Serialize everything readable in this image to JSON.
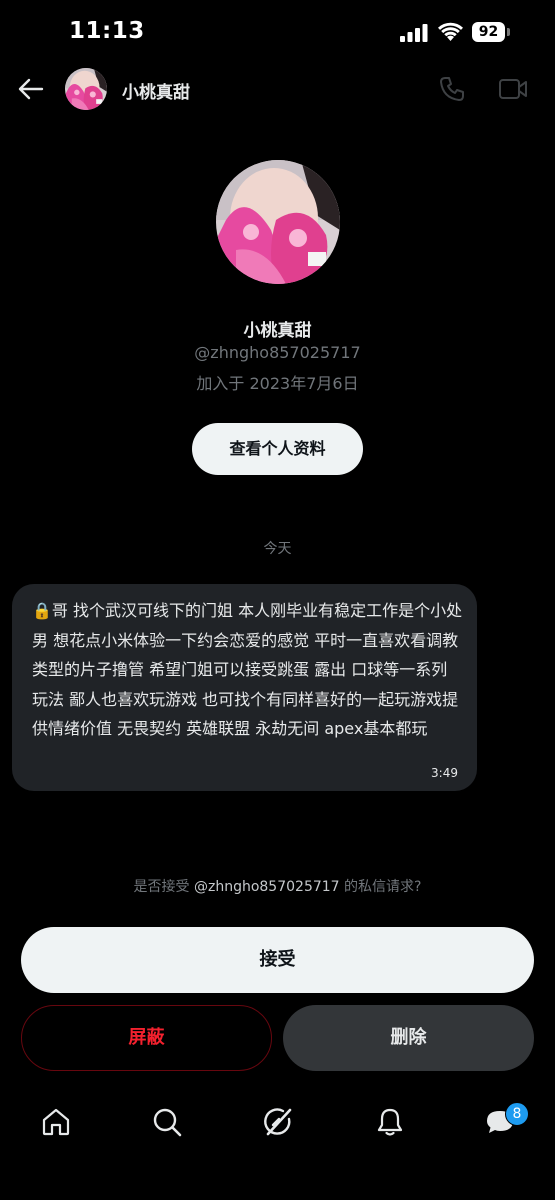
{
  "status_bar": {
    "time": "11:13",
    "battery": "92"
  },
  "header": {
    "name": "小桃真甜"
  },
  "profile": {
    "name": "小桃真甜",
    "handle": "@zhngho857025717",
    "joined": "加入于 2023年7月6日",
    "view_profile_label": "查看个人资料"
  },
  "conversation": {
    "date_divider": "今天",
    "messages": [
      {
        "text": "🔒哥 找个武汉可线下的门姐 本人刚毕业有稳定工作是个小处男 想花点小米体验一下约会恋爱的感觉 平时一直喜欢看调教类型的片子撸管 希望门姐可以接受跳蛋 露出 口球等一系列玩法 鄙人也喜欢玩游戏 也可找个有同样喜好的一起玩游戏提供情绪价值 无畏契约 英雄联盟 永劫无间 apex基本都玩",
        "time": "3:49"
      }
    ]
  },
  "request": {
    "prefix": "是否接受 ",
    "handle": "@zhngho857025717",
    "suffix": " 的私信请求?",
    "accept_label": "接受",
    "block_label": "屏蔽",
    "delete_label": "删除"
  },
  "bottom_nav": {
    "items": [
      "home-icon",
      "search-icon",
      "grok-icon",
      "notifications-icon",
      "messages-icon"
    ],
    "messages_badge": "8"
  },
  "colors": {
    "background": "#000000",
    "bubble": "#202327",
    "muted_text": "#71767b",
    "danger": "#f4212e",
    "accent": "#1d9bf0"
  }
}
